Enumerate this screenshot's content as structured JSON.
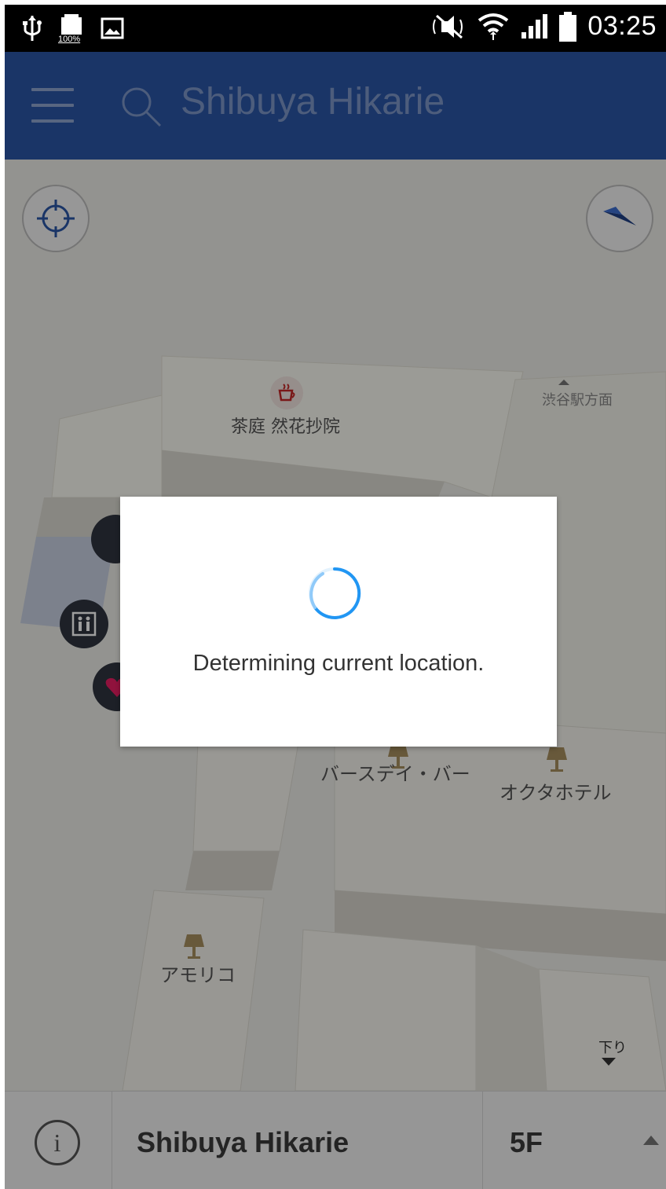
{
  "status_bar": {
    "time": "03:25",
    "battery_badge": "100%",
    "icons": [
      "usb-icon",
      "battery-icon",
      "image-icon",
      "mute-icon",
      "wifi-icon",
      "signal-icon",
      "battery-full-icon"
    ]
  },
  "app_bar": {
    "search_placeholder": "Shibuya Hikarie"
  },
  "map": {
    "labels": {
      "cafe": "茶庭 然花抄院",
      "shibuya_direction": "渋谷駅方面",
      "birthday_bar": "バースデイ・バー",
      "okuta_hotel": "オクタホテル",
      "amoriko": "アモリコ",
      "down": "下り"
    },
    "icons": [
      "locate-icon",
      "compass-icon",
      "cafe-icon",
      "elevator-icon",
      "heart-icon",
      "lamp-icon"
    ]
  },
  "dialog": {
    "message": "Determining current location."
  },
  "bottom_bar": {
    "building_name": "Shibuya Hikarie",
    "floor": "5F",
    "info_glyph": "i"
  },
  "colors": {
    "app_bar": "#2b56a7",
    "spinner": "#2196f3",
    "cafe_accent": "#c62828",
    "heart_accent": "#e91e63"
  }
}
